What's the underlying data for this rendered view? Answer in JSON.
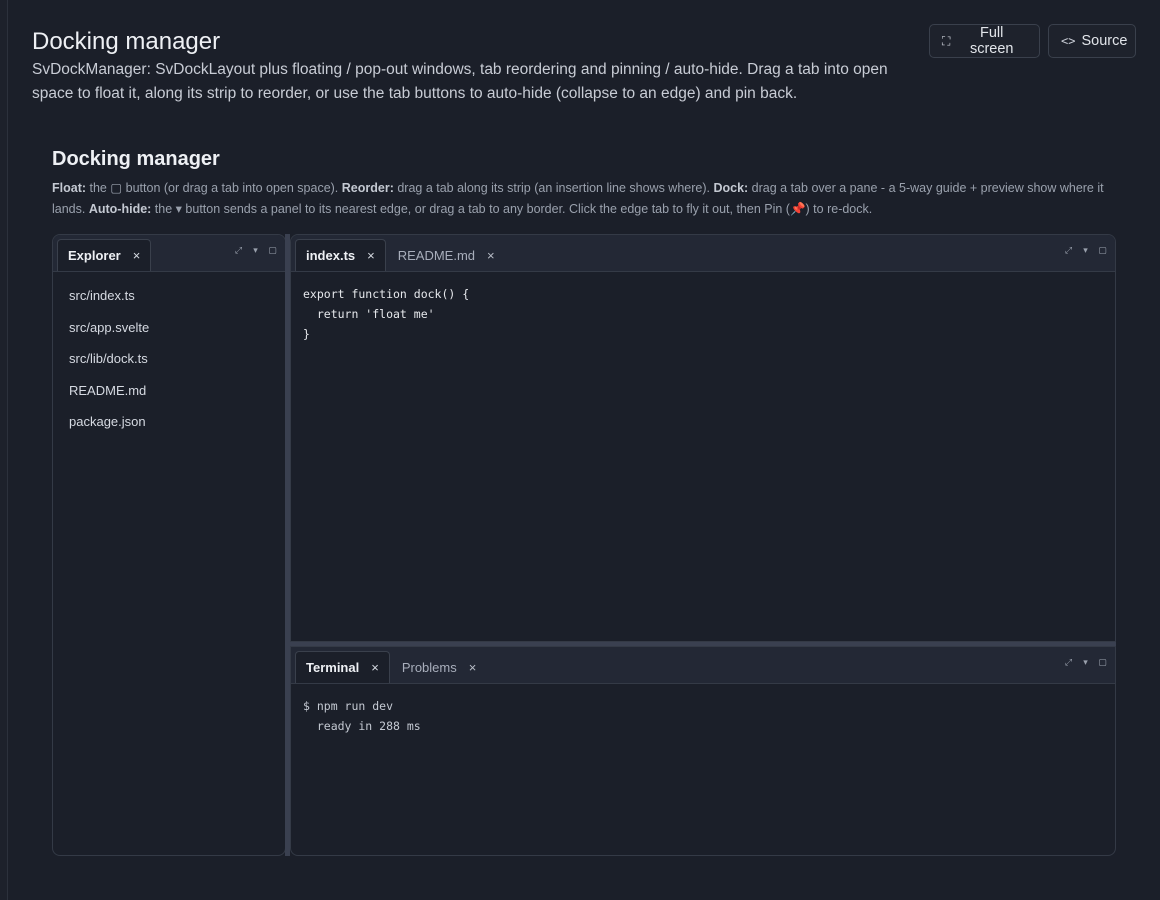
{
  "page": {
    "title": "Docking manager",
    "description": "SvDockManager: SvDockLayout plus floating / pop-out windows, tab reordering and pinning / auto-hide. Drag a tab into open space to float it, along its strip to reorder, or use the tab buttons to auto-hide (collapse to an edge) and pin back."
  },
  "toolbar": {
    "fullscreen_label": "Full screen",
    "fullscreen_icon": "⛶",
    "source_label": "Source",
    "source_icon": "<>"
  },
  "demo": {
    "title": "Docking manager",
    "help": {
      "float_label": "Float:",
      "float_text_a": " the ",
      "float_icon": "▢",
      "float_text_b": " button (or drag a tab into open space). ",
      "reorder_label": "Reorder:",
      "reorder_text": " drag a tab along its strip (an insertion line shows where). ",
      "dock_label": "Dock:",
      "dock_text": " drag a tab over a pane - a 5-way guide + preview show where it lands. ",
      "autohide_label": "Auto-hide:",
      "autohide_text_a": " the ",
      "autohide_icon": "▾",
      "autohide_text_b": " button sends a panel to its nearest edge, or drag a tab to any border. Click the edge tab to fly it out, then Pin (",
      "pin_icon": "📌",
      "autohide_text_c": ") to re-dock."
    }
  },
  "panes": {
    "explorer": {
      "tabs": [
        {
          "label": "Explorer",
          "close": "×"
        }
      ],
      "files": [
        "src/index.ts",
        "src/app.svelte",
        "src/lib/dock.ts",
        "README.md",
        "package.json"
      ]
    },
    "editor": {
      "tabs": [
        {
          "label": "index.ts",
          "close": "×"
        },
        {
          "label": "README.md",
          "close": "×"
        }
      ],
      "code": "export function dock() {\n  return 'float me'\n}"
    },
    "terminal": {
      "tabs": [
        {
          "label": "Terminal",
          "close": "×"
        },
        {
          "label": "Problems",
          "close": "×"
        }
      ],
      "output": "$ npm run dev\n  ready in 288 ms"
    },
    "actions": {
      "popout_icon": "⤢",
      "autohide_icon": "▾",
      "float_icon": "▢"
    }
  }
}
